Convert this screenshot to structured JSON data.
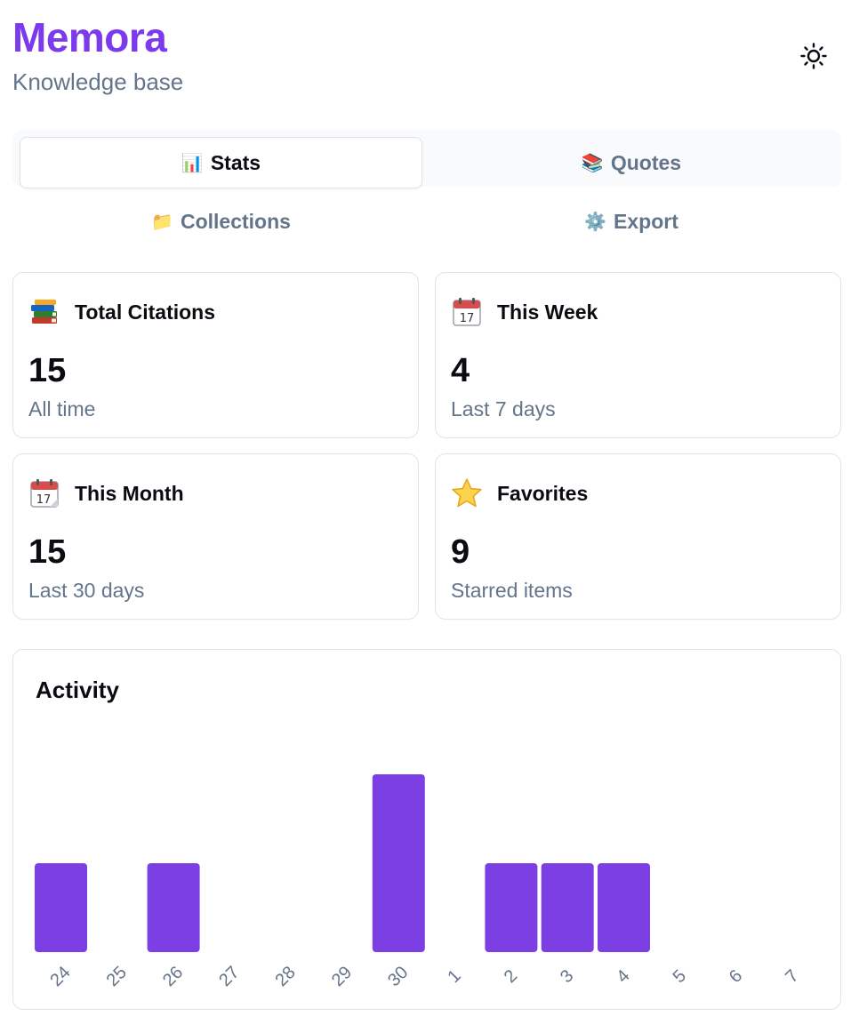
{
  "app": {
    "name": "Memora",
    "subtitle": "Knowledge base"
  },
  "header": {
    "theme_icon": "sun-icon"
  },
  "tabs": [
    {
      "emoji": "📊",
      "label": "Stats",
      "active": true
    },
    {
      "emoji": "📚",
      "label": "Quotes",
      "active": false
    },
    {
      "emoji": "📁",
      "label": "Collections",
      "active": false
    },
    {
      "emoji": "⚙️",
      "label": "Export",
      "active": false
    }
  ],
  "stats": [
    {
      "icon": "books-icon",
      "title": "Total Citations",
      "value": "15",
      "sub": "All time"
    },
    {
      "icon": "calendar-icon",
      "title": "This Week",
      "value": "4",
      "sub": "Last 7 days"
    },
    {
      "icon": "calendar-icon",
      "title": "This Month",
      "value": "15",
      "sub": "Last 30 days"
    },
    {
      "icon": "star-icon",
      "title": "Favorites",
      "value": "9",
      "sub": "Starred items"
    }
  ],
  "activity": {
    "title": "Activity",
    "chart_data": {
      "type": "bar",
      "categories": [
        "24",
        "25",
        "26",
        "27",
        "28",
        "29",
        "30",
        "1",
        "2",
        "3",
        "4",
        "5",
        "6",
        "7"
      ],
      "values": [
        1,
        0,
        1,
        0,
        0,
        0,
        2,
        0,
        1,
        1,
        1,
        0,
        0,
        0
      ],
      "ylim": [
        0,
        2
      ],
      "grid": false,
      "color": "#7b3fe4"
    }
  }
}
